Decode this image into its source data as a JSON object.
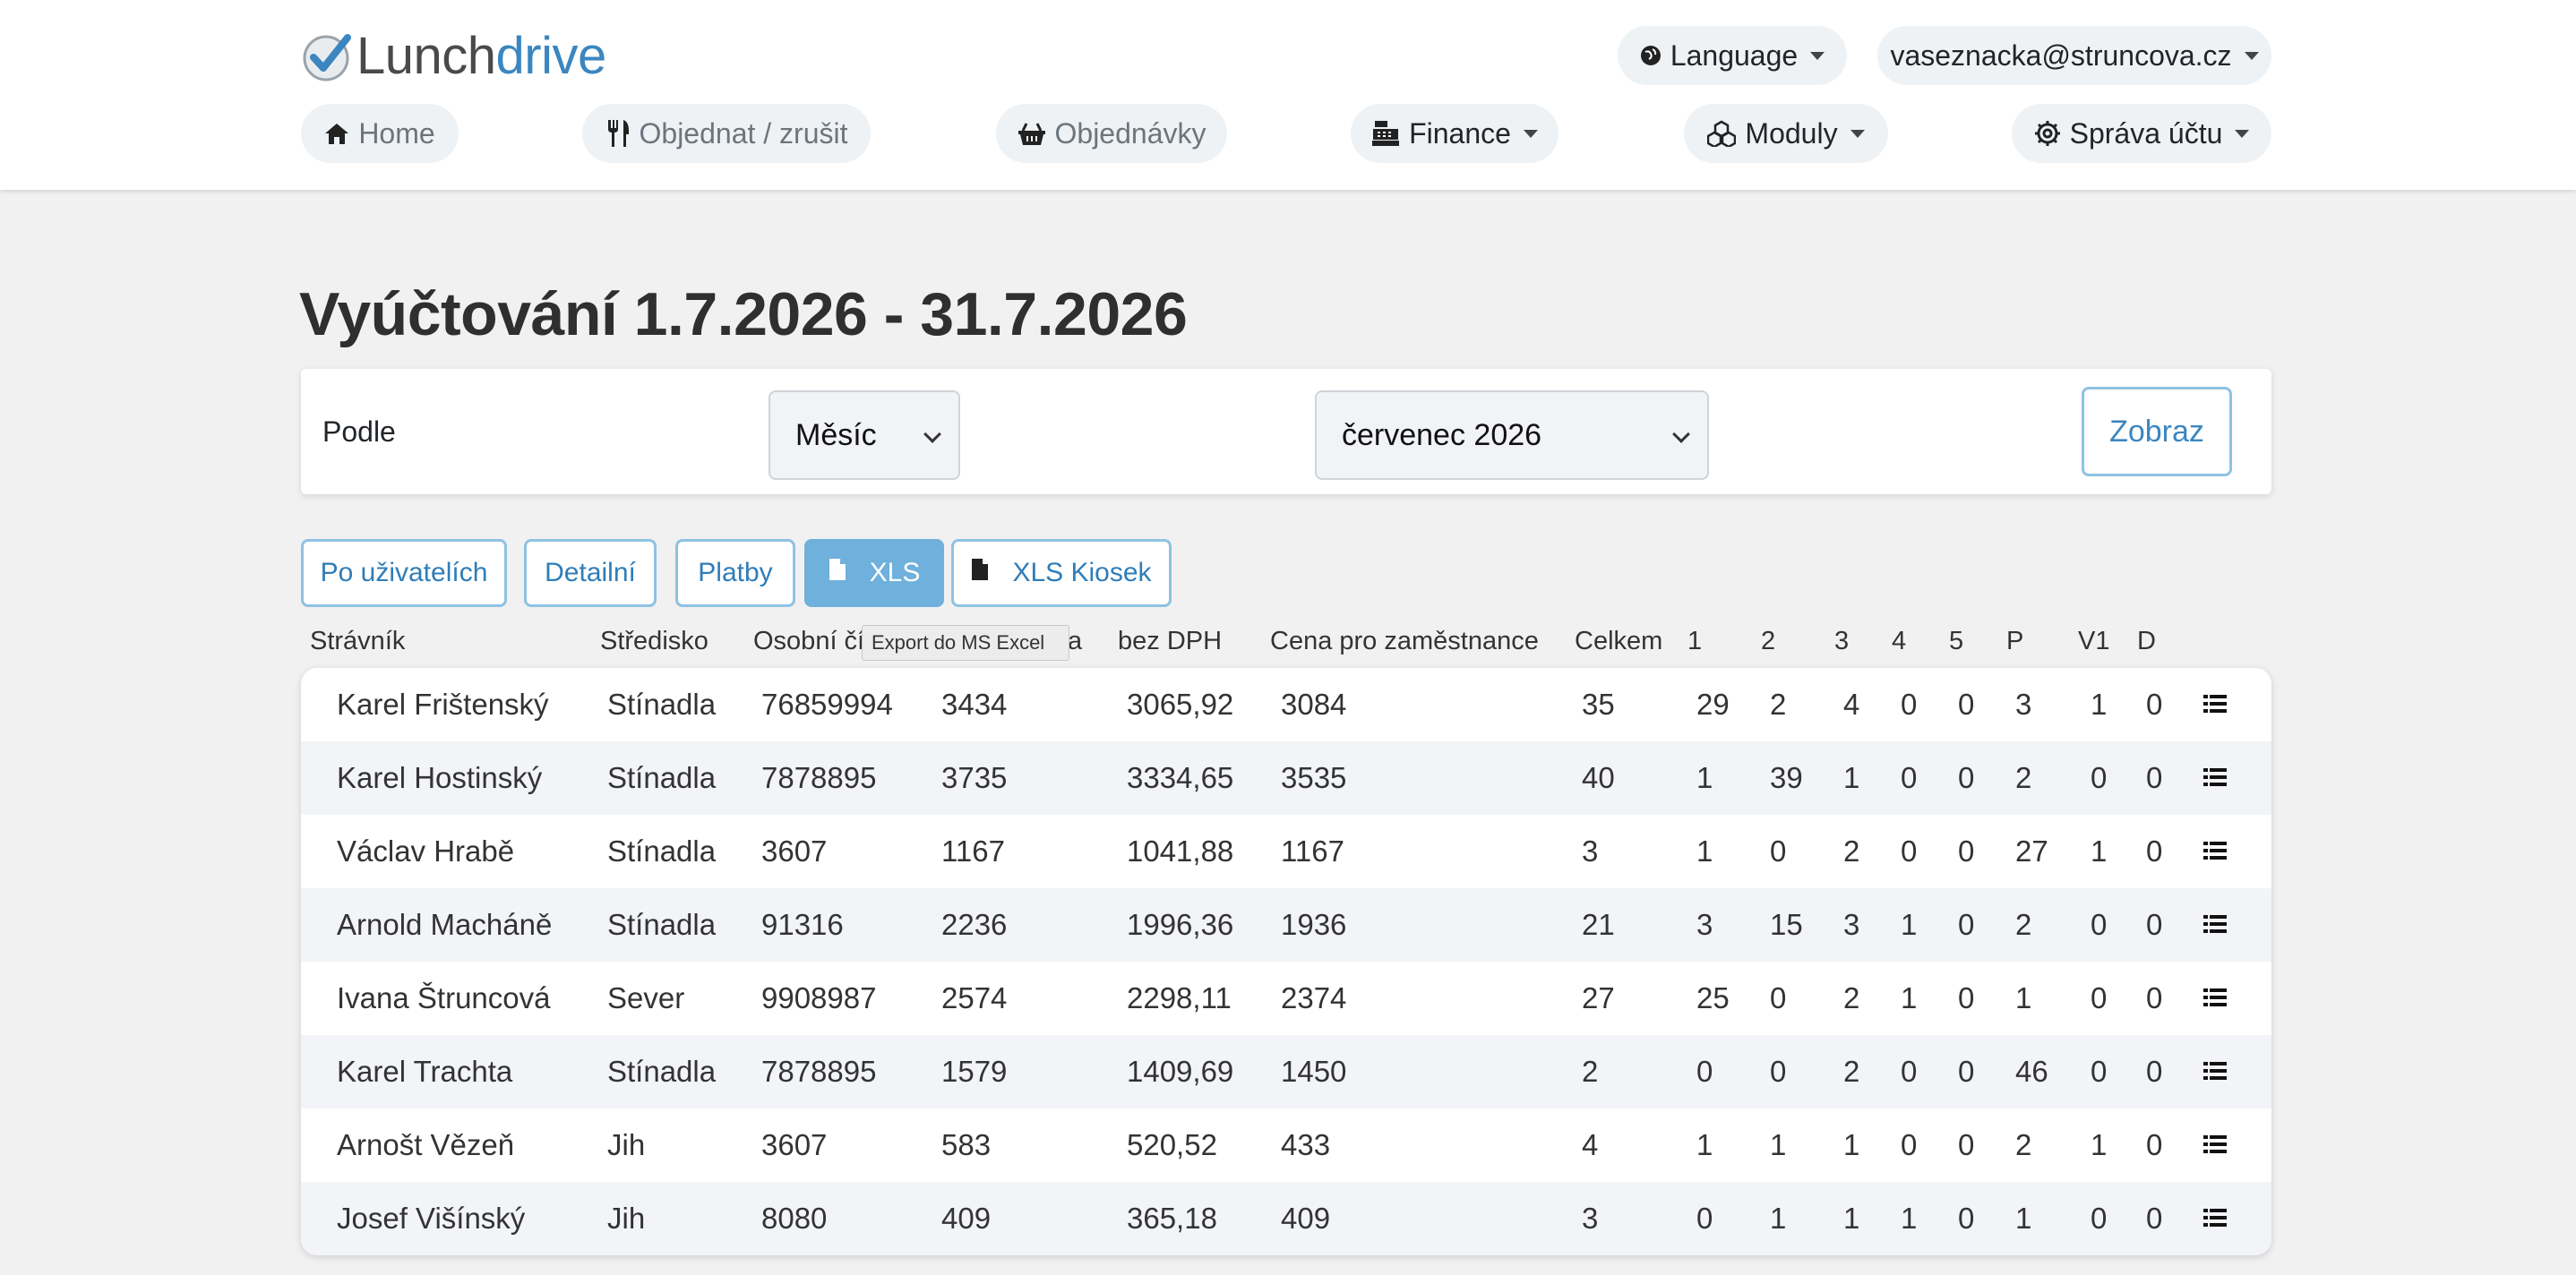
{
  "brand": {
    "part1": "Lunch",
    "part2": "drive",
    "accent_color": "#3b86c0"
  },
  "top_nav": {
    "language_label": "Language",
    "user_email": "vaseznacka@struncova.cz"
  },
  "main_nav": [
    {
      "label": "Home",
      "icon": "home-icon",
      "muted": true,
      "dropdown": false
    },
    {
      "label": "Objednat / zrušit",
      "icon": "cutlery-icon",
      "muted": true,
      "dropdown": false
    },
    {
      "label": "Objednávky",
      "icon": "basket-icon",
      "muted": true,
      "dropdown": false
    },
    {
      "label": "Finance",
      "icon": "cash-register-icon",
      "muted": false,
      "dropdown": true
    },
    {
      "label": "Moduly",
      "icon": "cubes-icon",
      "muted": false,
      "dropdown": true
    },
    {
      "label": "Správa účtu",
      "icon": "gear-icon",
      "muted": false,
      "dropdown": true
    }
  ],
  "page_title": "Vyúčtování 1.7.2026 - 31.7.2026",
  "filter": {
    "label": "Podle",
    "period_type": "Měsíc",
    "period_value": "červenec 2026",
    "submit_label": "Zobraz"
  },
  "view_buttons": [
    {
      "label": "Po uživatelích",
      "active": false,
      "icon": ""
    },
    {
      "label": "Detailní",
      "active": false,
      "icon": ""
    },
    {
      "label": "Platby",
      "active": false,
      "icon": ""
    },
    {
      "label": "XLS",
      "active": true,
      "icon": "file-icon"
    },
    {
      "label": "XLS Kiosek",
      "active": false,
      "icon": "file-icon"
    }
  ],
  "tooltip": "Export do MS Excel",
  "table": {
    "headers": [
      "Strávník",
      "Středisko",
      "Osobní čís",
      "a",
      "bez DPH",
      "Cena pro zaměstnance",
      "Celkem",
      "1",
      "2",
      "3",
      "4",
      "5",
      "P",
      "V1",
      "D"
    ],
    "rows": [
      [
        "Karel Frištenský",
        "Stínadla",
        "76859994",
        "3434",
        "3065,92",
        "3084",
        "35",
        "29",
        "2",
        "4",
        "0",
        "0",
        "3",
        "1",
        "0"
      ],
      [
        "Karel Hostinský",
        "Stínadla",
        "7878895",
        "3735",
        "3334,65",
        "3535",
        "40",
        "1",
        "39",
        "1",
        "0",
        "0",
        "2",
        "0",
        "0"
      ],
      [
        "Václav Hrabě",
        "Stínadla",
        "3607",
        "1167",
        "1041,88",
        "1167",
        "3",
        "1",
        "0",
        "2",
        "0",
        "0",
        "27",
        "1",
        "0"
      ],
      [
        "Arnold Macháně",
        "Stínadla",
        "91316",
        "2236",
        "1996,36",
        "1936",
        "21",
        "3",
        "15",
        "3",
        "1",
        "0",
        "2",
        "0",
        "0"
      ],
      [
        "Ivana Štruncová",
        "Sever",
        "9908987",
        "2574",
        "2298,11",
        "2374",
        "27",
        "25",
        "0",
        "2",
        "1",
        "0",
        "1",
        "0",
        "0"
      ],
      [
        "Karel Trachta",
        "Stínadla",
        "7878895",
        "1579",
        "1409,69",
        "1450",
        "2",
        "0",
        "0",
        "2",
        "0",
        "0",
        "46",
        "0",
        "0"
      ],
      [
        "Arnošt Vězeň",
        "Jih",
        "3607",
        "583",
        "520,52",
        "433",
        "4",
        "1",
        "1",
        "1",
        "0",
        "0",
        "2",
        "1",
        "0"
      ],
      [
        "Josef Višínský",
        "Jih",
        "8080",
        "409",
        "365,18",
        "409",
        "3",
        "0",
        "1",
        "1",
        "1",
        "0",
        "1",
        "0",
        "0"
      ]
    ],
    "row_action_icon": "list-icon"
  }
}
